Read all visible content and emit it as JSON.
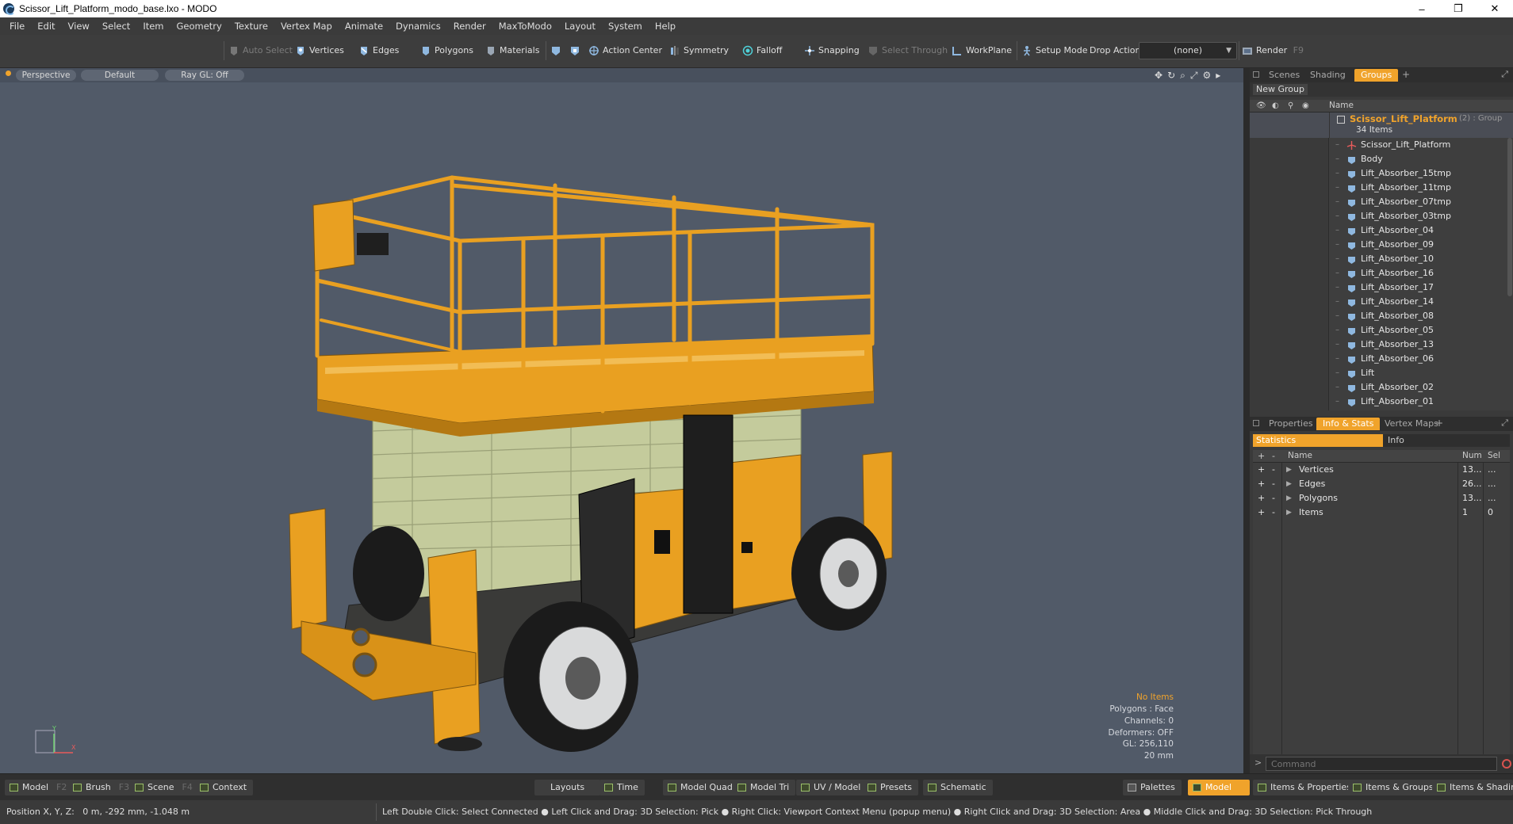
{
  "window": {
    "title": "Scissor_Lift_Platform_modo_base.lxo - MODO",
    "minimize": "–",
    "restore": "❐",
    "close": "✕"
  },
  "menu": [
    "File",
    "Edit",
    "View",
    "Select",
    "Item",
    "Geometry",
    "Texture",
    "Vertex Map",
    "Animate",
    "Dynamics",
    "Render",
    "MaxToModo",
    "Layout",
    "System",
    "Help"
  ],
  "toolbar": {
    "auto_select": "Auto Select",
    "vertices": "Vertices",
    "edges": "Edges",
    "polygons": "Polygons",
    "materials": "Materials",
    "action_center": "Action Center",
    "symmetry": "Symmetry",
    "falloff": "Falloff",
    "snapping": "Snapping",
    "select_through": "Select Through",
    "workplane": "WorkPlane",
    "setup_mode": "Setup Mode",
    "drop_action": "Drop Action",
    "drop_value": "(none)",
    "render": "Render",
    "render_key": "F9"
  },
  "viewport": {
    "perspective": "Perspective",
    "default": "Default",
    "raygl": "Ray GL: Off",
    "stats": {
      "no_items": "No Items",
      "polygons": "Polygons : Face",
      "channels": "Channels: 0",
      "deformers": "Deformers: OFF",
      "gl": "GL: 256,110",
      "scale": "20 mm"
    }
  },
  "scene_panel": {
    "tabs": [
      "Scenes",
      "Shading",
      "Groups"
    ],
    "active_tab": "Groups",
    "new_group": "New Group",
    "name_header": "Name",
    "group_name": "Scissor_Lift_Platform",
    "group_suffix": "(2) : Group",
    "group_count": "34 Items",
    "items": [
      "Scissor_Lift_Platform",
      "Body",
      "Lift_Absorber_15tmp",
      "Lift_Absorber_11tmp",
      "Lift_Absorber_07tmp",
      "Lift_Absorber_03tmp",
      "Lift_Absorber_04",
      "Lift_Absorber_09",
      "Lift_Absorber_10",
      "Lift_Absorber_16",
      "Lift_Absorber_17",
      "Lift_Absorber_14",
      "Lift_Absorber_08",
      "Lift_Absorber_05",
      "Lift_Absorber_13",
      "Lift_Absorber_06",
      "Lift",
      "Lift_Absorber_02",
      "Lift_Absorber_01"
    ]
  },
  "info_panel": {
    "tabs": [
      "Properties",
      "Info & Stats",
      "Vertex Maps"
    ],
    "active_tab": "Info & Stats",
    "stat_tabs": [
      "Statistics",
      "Info"
    ],
    "headers": {
      "name": "Name",
      "num": "Num",
      "sel": "Sel"
    },
    "rows": [
      {
        "name": "Vertices",
        "num": "13...",
        "sel": "..."
      },
      {
        "name": "Edges",
        "num": "26...",
        "sel": "..."
      },
      {
        "name": "Polygons",
        "num": "13...",
        "sel": "..."
      },
      {
        "name": "Items",
        "num": "1",
        "sel": "0"
      }
    ],
    "command_placeholder": "Command"
  },
  "bottombar": {
    "model": "Model",
    "model_key": "F2",
    "brush": "Brush",
    "brush_key": "F3",
    "scene": "Scene",
    "scene_key": "F4",
    "context": "Context",
    "layouts": "Layouts",
    "time": "Time",
    "model_quad": "Model Quad",
    "model_tri": "Model Tri",
    "uv_model": "UV / Model",
    "presets": "Presets",
    "schematic": "Schematic",
    "palettes": "Palettes",
    "model_active": "Model",
    "items_props": "Items & Properties",
    "items_groups": "Items & Groups",
    "items_shading": "Items & Shading"
  },
  "status": {
    "position": "Position X, Y, Z:   0 m, -292 mm, -1.048 m",
    "hints": "Left Double Click: Select Connected ●  Left Click and Drag: 3D Selection: Pick ●  Right Click: Viewport Context Menu (popup menu) ●  Right Click and Drag: 3D Selection: Area ●  Middle Click and Drag: 3D Selection: Pick Through"
  },
  "colors": {
    "accent": "#f0a32b",
    "viewport_bg": "#515a68",
    "lift_yellow": "#e9a021",
    "scissor_green": "#c9cfa0"
  }
}
